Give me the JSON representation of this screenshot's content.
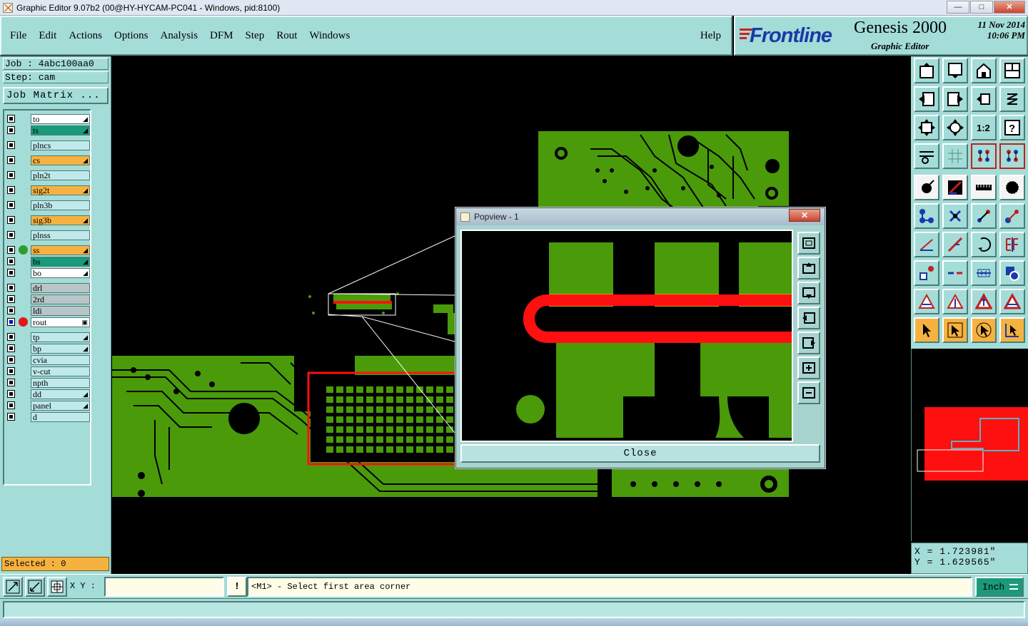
{
  "window": {
    "title": "Graphic Editor 9.07b2 (00@HY-HYCAM-PC041 - Windows, pid:8100)"
  },
  "menu": {
    "items": [
      {
        "label": "File"
      },
      {
        "label": "Edit"
      },
      {
        "label": "Actions"
      },
      {
        "label": "Options"
      },
      {
        "label": "Analysis"
      },
      {
        "label": "DFM"
      },
      {
        "label": "Step"
      },
      {
        "label": "Rout"
      },
      {
        "label": "Windows"
      }
    ],
    "help": "Help"
  },
  "brand": {
    "logo": "Frontline",
    "product": "Genesis 2000",
    "subtitle": "Graphic Editor",
    "date": "11 Nov 2014",
    "time": "10:06 PM"
  },
  "job": {
    "job_line": "Job : 4abc100aa0",
    "step_line": "Step: cam",
    "matrix_button": "Job Matrix ..."
  },
  "layers": [
    {
      "name": "to",
      "color": "#ffffff",
      "flag": "◢",
      "dot": ""
    },
    {
      "name": "ts",
      "color": "#1a9a7a",
      "flag": "◢",
      "dot": ""
    },
    {
      "name": "plncs",
      "color": "#bfe9ea",
      "flag": "",
      "dot": ""
    },
    {
      "name": "cs",
      "color": "#f6b240",
      "flag": "◢",
      "dot": ""
    },
    {
      "name": "pln2t",
      "color": "#bfe9ea",
      "flag": "",
      "dot": ""
    },
    {
      "name": "sig2t",
      "color": "#f6b240",
      "flag": "◢",
      "dot": ""
    },
    {
      "name": "pln3b",
      "color": "#bfe9ea",
      "flag": "",
      "dot": ""
    },
    {
      "name": "sig3b",
      "color": "#f6b240",
      "flag": "◢",
      "dot": ""
    },
    {
      "name": "plnss",
      "color": "#bfe9ea",
      "flag": "",
      "dot": ""
    },
    {
      "name": "ss",
      "color": "#f6b240",
      "flag": "◢",
      "dot": "#2aa02a"
    },
    {
      "name": "bs",
      "color": "#1a9a7a",
      "flag": "◢",
      "dot": ""
    },
    {
      "name": "bo",
      "color": "#ffffff",
      "flag": "◢",
      "dot": ""
    },
    {
      "name": "drl",
      "color": "#b8c6c8",
      "flag": "",
      "dot": ""
    },
    {
      "name": "2rd",
      "color": "#b8c6c8",
      "flag": "",
      "dot": ""
    },
    {
      "name": "ldi",
      "color": "#b8c6c8",
      "flag": "",
      "dot": ""
    },
    {
      "name": "rout",
      "color": "#ffffff",
      "flag": "▣",
      "dot": "#e01818",
      "active": true
    },
    {
      "name": "tp",
      "color": "#bfe9ea",
      "flag": "◢",
      "dot": ""
    },
    {
      "name": "bp",
      "color": "#bfe9ea",
      "flag": "◢",
      "dot": ""
    },
    {
      "name": "cvia",
      "color": "#bfe9ea",
      "flag": "",
      "dot": ""
    },
    {
      "name": "v-cut",
      "color": "#bfe9ea",
      "flag": "",
      "dot": ""
    },
    {
      "name": "npth",
      "color": "#bfe9ea",
      "flag": "",
      "dot": ""
    },
    {
      "name": "dd",
      "color": "#bfe9ea",
      "flag": "◢",
      "dot": ""
    },
    {
      "name": "panel",
      "color": "#bfe9ea",
      "flag": "◢",
      "dot": ""
    },
    {
      "name": "d",
      "color": "#bfe9ea",
      "flag": "",
      "dot": ""
    }
  ],
  "selected": "Selected : 0",
  "popview": {
    "title": "Popview - 1",
    "close_x": "✕",
    "close_button": "Close"
  },
  "coords": {
    "x": "X = 1.723981\"",
    "y": "Y = 1.629565\""
  },
  "bottom": {
    "xy_label": "X Y :",
    "xy_value": "",
    "prompt": "<M1> - Select first area corner",
    "units": "Inch",
    "alert": "!"
  },
  "colors": {
    "copper": "#4a9a0a",
    "rout": "#ff1010",
    "panel_bg": "#a4dcd8",
    "overlap": "#c8a000"
  },
  "window_buttons": {
    "min": "—",
    "max": "□",
    "close": "✕"
  }
}
